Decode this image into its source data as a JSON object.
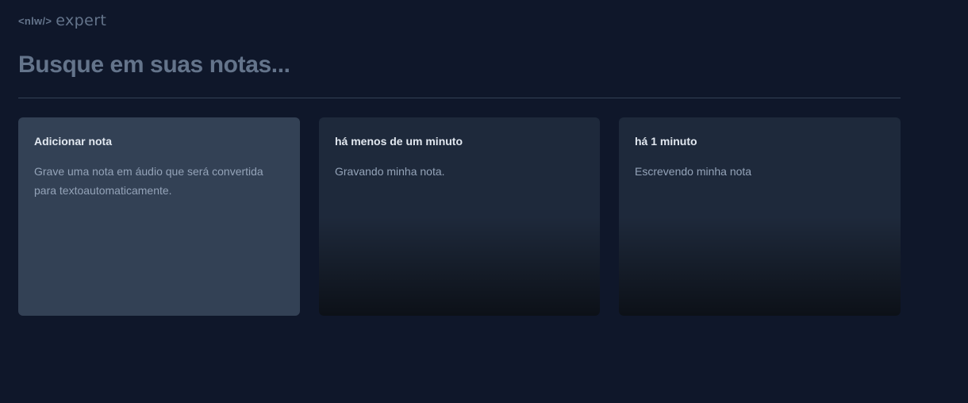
{
  "logo": {
    "tag": "<nlw/>",
    "word": "expert"
  },
  "search": {
    "placeholder": "Busque em suas notas..."
  },
  "add_card": {
    "title": "Adicionar nota",
    "description": "Grave uma nota em áudio que será convertida para textoautomaticamente."
  },
  "notes": [
    {
      "date": "há menos de um minuto",
      "content": "Gravando minha nota."
    },
    {
      "date": "há 1 minuto",
      "content": "Escrevendo minha nota"
    }
  ],
  "colors": {
    "background": "#0f172a",
    "add_card": "#334155",
    "note_card": "#1e293b",
    "title_text": "#e2e8f0",
    "body_text": "#94a3b8",
    "muted": "#64748b"
  }
}
